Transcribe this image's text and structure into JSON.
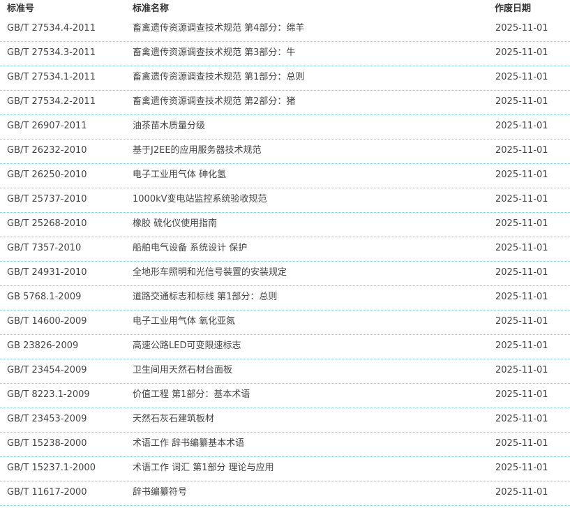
{
  "table": {
    "headers": {
      "code": "标准号",
      "name": "标准名称",
      "date": "作废日期"
    },
    "rows": [
      {
        "code": "GB/T 27534.4-2011",
        "name": "畜禽遗传资源调查技术规范 第4部分：绵羊",
        "date": "2025-11-01"
      },
      {
        "code": "GB/T 27534.3-2011",
        "name": "畜禽遗传资源调查技术规范 第3部分：牛",
        "date": "2025-11-01"
      },
      {
        "code": "GB/T 27534.1-2011",
        "name": "畜禽遗传资源调查技术规范 第1部分：总则",
        "date": "2025-11-01"
      },
      {
        "code": "GB/T 27534.2-2011",
        "name": "畜禽遗传资源调查技术规范 第2部分：猪",
        "date": "2025-11-01"
      },
      {
        "code": "GB/T 26907-2011",
        "name": "油茶苗木质量分级",
        "date": "2025-11-01"
      },
      {
        "code": "GB/T 26232-2010",
        "name": "基于J2EE的应用服务器技术规范",
        "date": "2025-11-01"
      },
      {
        "code": "GB/T 26250-2010",
        "name": "电子工业用气体 砷化氢",
        "date": "2025-11-01"
      },
      {
        "code": "GB/T 25737-2010",
        "name": "1000kV变电站监控系统验收规范",
        "date": "2025-11-01"
      },
      {
        "code": "GB/T 25268-2010",
        "name": "橡胶 硫化仪使用指南",
        "date": "2025-11-01"
      },
      {
        "code": "GB/T 7357-2010",
        "name": "船舶电气设备 系统设计 保护",
        "date": "2025-11-01"
      },
      {
        "code": "GB/T 24931-2010",
        "name": "全地形车照明和光信号装置的安装规定",
        "date": "2025-11-01"
      },
      {
        "code": "GB 5768.1-2009",
        "name": "道路交通标志和标线 第1部分：总则",
        "date": "2025-11-01"
      },
      {
        "code": "GB/T 14600-2009",
        "name": "电子工业用气体 氧化亚氮",
        "date": "2025-11-01"
      },
      {
        "code": "GB 23826-2009",
        "name": "高速公路LED可变限速标志",
        "date": "2025-11-01"
      },
      {
        "code": "GB/T 23454-2009",
        "name": "卫生间用天然石材台面板",
        "date": "2025-11-01"
      },
      {
        "code": "GB/T 8223.1-2009",
        "name": "价值工程 第1部分：基本术语",
        "date": "2025-11-01"
      },
      {
        "code": "GB/T 23453-2009",
        "name": "天然石灰石建筑板材",
        "date": "2025-11-01"
      },
      {
        "code": "GB/T 15238-2000",
        "name": "术语工作 辞书编纂基本术语",
        "date": "2025-11-01"
      },
      {
        "code": "GB/T 15237.1-2000",
        "name": "术语工作 词汇 第1部分 理论与应用",
        "date": "2025-11-01"
      },
      {
        "code": "GB/T 11617-2000",
        "name": "辞书编纂符号",
        "date": "2025-11-01"
      }
    ]
  }
}
